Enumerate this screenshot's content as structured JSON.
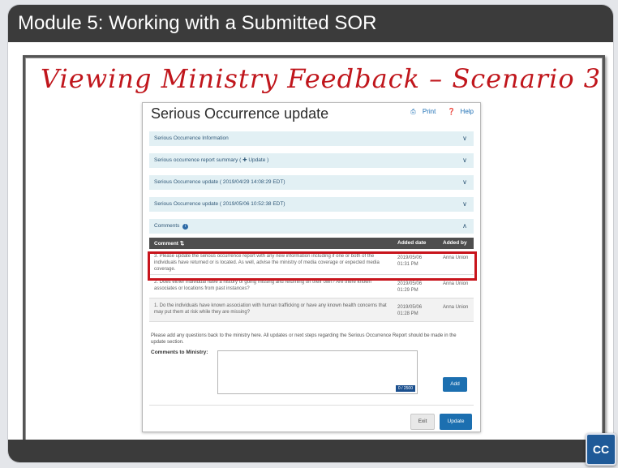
{
  "module_title": "Module 5:  Working with a Submitted SOR",
  "slide_heading": "Viewing Ministry Feedback – Scenario 3",
  "panel": {
    "title": "Serious Occurrence update",
    "print_label": "Print",
    "help_label": "Help",
    "sections": [
      {
        "label": "Serious Occurrence Information",
        "state": "collapsed"
      },
      {
        "label": "Serious occurrence report summary ( ✚ Update )",
        "state": "collapsed"
      },
      {
        "label": "Serious Occurrence update ( 2019/04/29 14:08:29 EDT)",
        "state": "collapsed"
      },
      {
        "label": "Serious Occurrence update ( 2019/05/06 10:52:38 EDT)",
        "state": "collapsed"
      },
      {
        "label": "Comments",
        "state": "expanded"
      }
    ],
    "comments_table": {
      "headers": [
        "Comment ⇅",
        "Added date",
        "Added by"
      ],
      "rows": [
        {
          "comment": "3. Please update the serious occurrence report with any new information including if one or both of the individuals have returned or is located. As well, advise the ministry of media coverage or expected media coverage.",
          "date": "2019/05/06 01:31 PM",
          "by": "Anna Union",
          "highlighted": true
        },
        {
          "comment": "2. Does either individual have a history of going missing and returning on their own? Are there known associates or locations from past instances?",
          "date": "2019/05/06 01:29 PM",
          "by": "Anna Union",
          "highlighted": false
        },
        {
          "comment": "1. Do the individuals have known association with human trafficking or have any known health concerns that may put them at risk while they are missing?",
          "date": "2019/05/06 01:28 PM",
          "by": "Anna Union",
          "highlighted": false
        }
      ]
    },
    "note": "Please add any questions back to the ministry here. All updates or next steps regarding the Serious Occurrence Report should be made in the update section.",
    "comments_label": "Comments to Ministry:",
    "char_counter": "0 / 2500",
    "add_label": "Add",
    "exit_label": "Exit",
    "update_label": "Update"
  },
  "cc_label": "CC",
  "colors": {
    "title_bar": "#3b3b3b",
    "heading": "#c0161c",
    "accordion": "#e2f0f4",
    "primary_button": "#1c6fb0",
    "highlight_border": "#c8141c"
  }
}
